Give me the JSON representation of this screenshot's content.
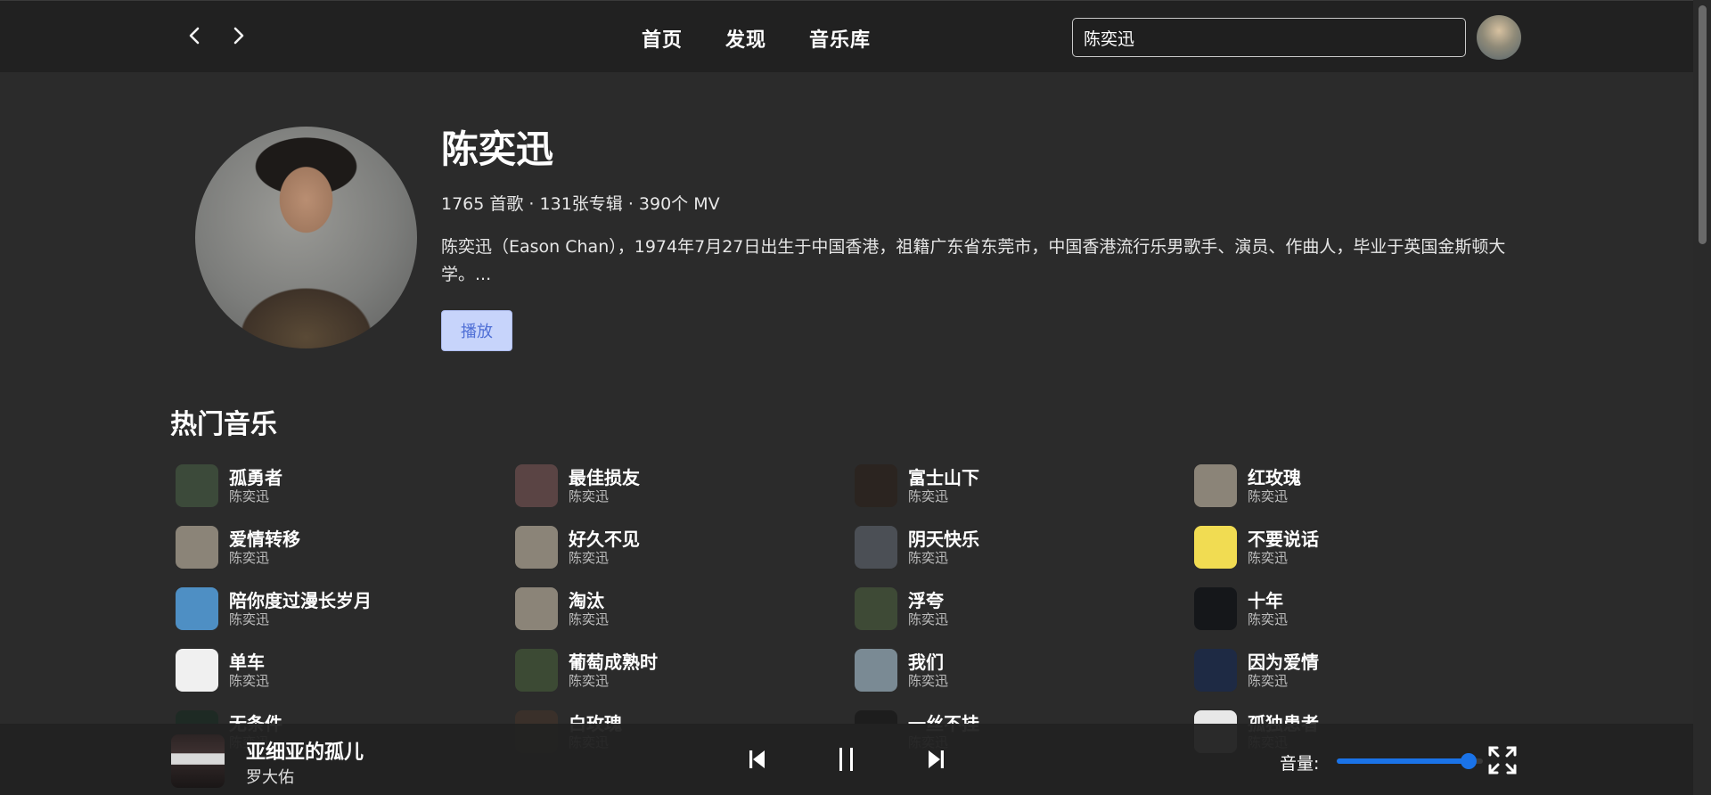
{
  "header": {
    "back_icon": "chevron-left-icon",
    "forward_icon": "chevron-right-icon",
    "nav": [
      {
        "label": "首页"
      },
      {
        "label": "发现"
      },
      {
        "label": "音乐库"
      }
    ],
    "search": {
      "value": "陈奕迅",
      "placeholder": ""
    }
  },
  "artist": {
    "name": "陈奕迅",
    "stats": "1765 首歌 · 131张专辑 · 390个 MV",
    "description": "陈奕迅（Eason Chan），1974年7月27日出生于中国香港，祖籍广东省东莞市，中国香港流行乐男歌手、演员、作曲人，毕业于英国金斯顿大学。...",
    "play_label": "播放"
  },
  "hot_section": {
    "title": "热门音乐"
  },
  "songs": [
    {
      "title": "孤勇者",
      "artist": "陈奕迅",
      "cover": "#3c4a3a"
    },
    {
      "title": "最佳损友",
      "artist": "陈奕迅",
      "cover": "#5a4444"
    },
    {
      "title": "富士山下",
      "artist": "陈奕迅",
      "cover": "#2b2420"
    },
    {
      "title": "红玫瑰",
      "artist": "陈奕迅",
      "cover": "#8b8478"
    },
    {
      "title": "爱情转移",
      "artist": "陈奕迅",
      "cover": "#8b8478"
    },
    {
      "title": "好久不见",
      "artist": "陈奕迅",
      "cover": "#8b8478"
    },
    {
      "title": "阴天快乐",
      "artist": "陈奕迅",
      "cover": "#4b4f55"
    },
    {
      "title": "不要说话",
      "artist": "陈奕迅",
      "cover": "#f1dc52"
    },
    {
      "title": "陪你度过漫长岁月",
      "artist": "陈奕迅",
      "cover": "#4e8fc4"
    },
    {
      "title": "淘汰",
      "artist": "陈奕迅",
      "cover": "#8b8478"
    },
    {
      "title": "浮夸",
      "artist": "陈奕迅",
      "cover": "#3e4a36"
    },
    {
      "title": "十年",
      "artist": "陈奕迅",
      "cover": "#15171a"
    },
    {
      "title": "单车",
      "artist": "陈奕迅",
      "cover": "#f0f0f0"
    },
    {
      "title": "葡萄成熟时",
      "artist": "陈奕迅",
      "cover": "#3c4a34"
    },
    {
      "title": "我们",
      "artist": "陈奕迅",
      "cover": "#7a8a94"
    },
    {
      "title": "因为爱情",
      "artist": "陈奕迅",
      "cover": "#1e2a44"
    },
    {
      "title": "无条件",
      "artist": "陈奕迅",
      "cover": "#1e2a24"
    },
    {
      "title": "白玫瑰",
      "artist": "陈奕迅",
      "cover": "#3a302a"
    },
    {
      "title": "一丝不挂",
      "artist": "陈奕迅",
      "cover": "#1d1d1d"
    },
    {
      "title": "孤独患者",
      "artist": "陈奕迅",
      "cover": "#e8e8e8"
    }
  ],
  "player": {
    "title": "亚细亚的孤儿",
    "artist": "罗大佑",
    "volume_label": "音量:",
    "volume": 0.9,
    "prev_icon": "skip-previous-icon",
    "pause_icon": "pause-icon",
    "next_icon": "skip-next-icon",
    "fullscreen_icon": "fullscreen-icon"
  },
  "colors": {
    "accent": "#1a73e8",
    "play_button_bg": "#c7d4fb",
    "play_button_text": "#4f6fd6",
    "background": "#2b2b2b",
    "topbar": "#212121"
  }
}
